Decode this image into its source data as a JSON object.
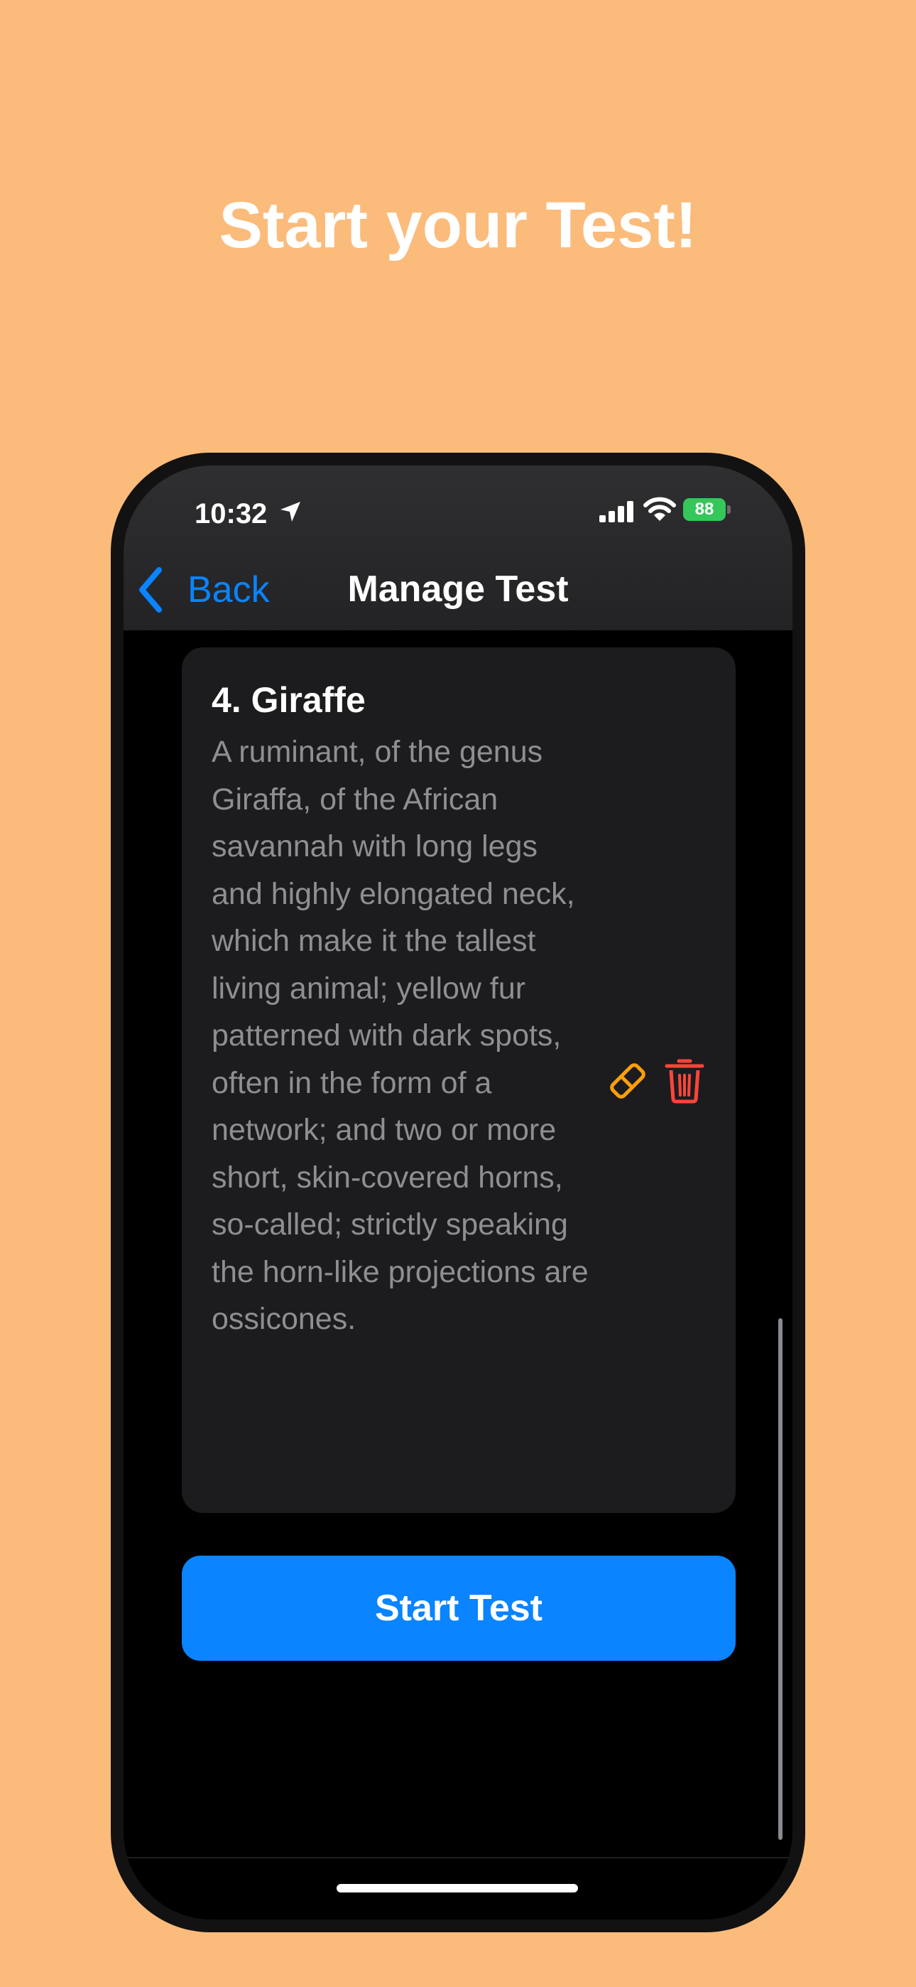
{
  "headline": "Start your Test!",
  "status_bar": {
    "time": "10:32",
    "battery": "88",
    "icons": [
      "location-arrow-icon",
      "cellular-signal-icon",
      "wifi-icon",
      "battery-charging-icon"
    ]
  },
  "nav": {
    "back_label": "Back",
    "title": "Manage Test"
  },
  "card": {
    "title": "4. Giraffe",
    "description": "A ruminant, of the genus Giraffa, of the African savannah with long legs and highly elongated neck, which make it the tallest living animal; yellow fur patterned with dark spots, often in the form of a network; and two or more short, skin-covered horns, so-called; strictly speaking the horn-like projections are ossicones.",
    "actions": [
      "eraser-icon",
      "trash-icon"
    ]
  },
  "start_button": "Start Test",
  "colors": {
    "background": "#FBBB7B",
    "accent": "#0A84FF",
    "edit": "#FF9F0A",
    "delete": "#FF453A",
    "card": "#1C1C1E",
    "description_text": "#8E8E93"
  }
}
